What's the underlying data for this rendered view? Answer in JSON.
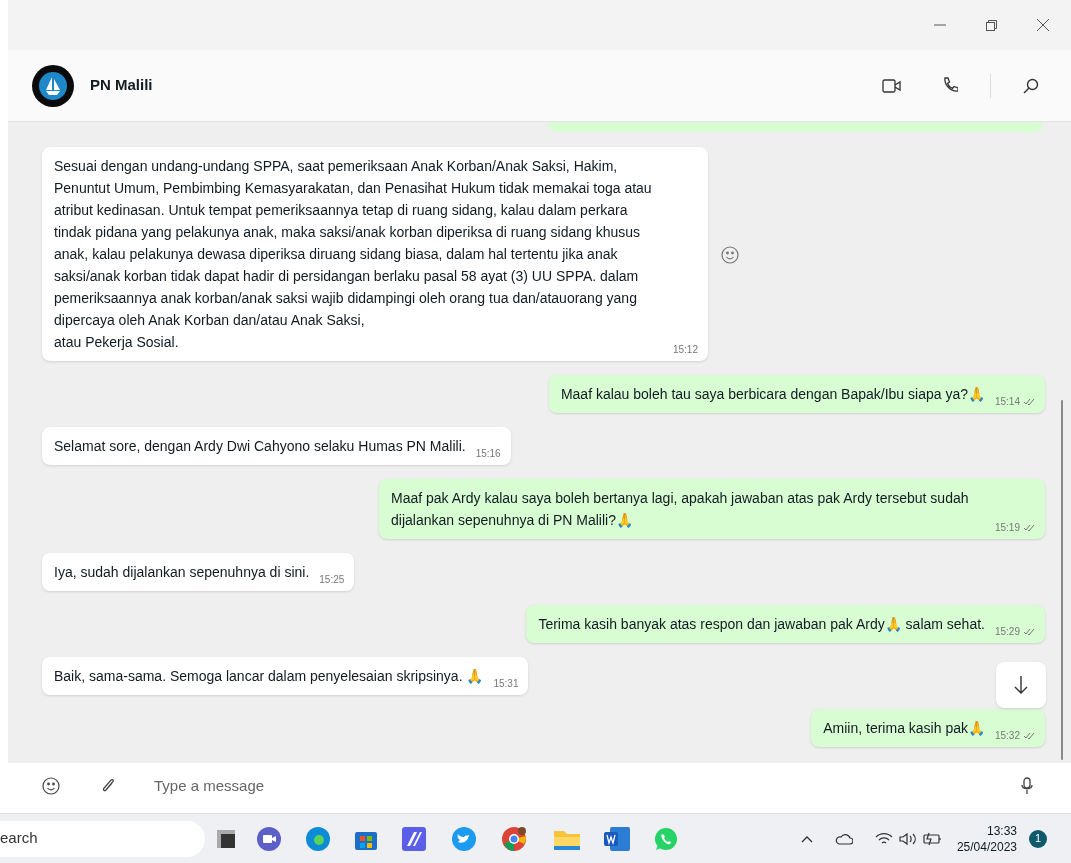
{
  "chat": {
    "name": "PN Malili"
  },
  "messages": [
    {
      "kind": "incoming",
      "text": "Sesuai dengan undang-undang SPPA, saat pemeriksaan Anak Korban/Anak Saksi, Hakim, Penuntut Umum, Pembimbing Kemasyarakatan, dan Penasihat Hukum tidak memakai toga atau atribut kedinasan. Untuk tempat pemeriksaannya tetap di ruang sidang, kalau dalam perkara tindak pidana yang pelakunya anak, maka saksi/anak korban diperiksa di ruang sidang khusus anak, kalau pelakunya dewasa diperiksa diruang sidang biasa, dalam hal tertentu jika anak saksi/anak korban tidak dapat hadir di persidangan berlaku pasal 58 ayat (3) UU SPPA. dalam pemeriksaannya anak korban/anak saksi wajib didampingi oleh orang tua dan/atauorang yang dipercaya oleh Anak Korban dan/atau Anak Saksi,\natau Pekerja Sosial.",
      "time": "15:12"
    },
    {
      "kind": "outgoing",
      "text": "Maaf kalau boleh tau saya berbicara dengan Bapak/Ibu siapa ya?🙏",
      "time": "15:14"
    },
    {
      "kind": "incoming",
      "text": "Selamat sore, dengan Ardy Dwi Cahyono selaku Humas PN Malili.",
      "time": "15:16"
    },
    {
      "kind": "outgoing",
      "text": "Maaf pak Ardy kalau saya boleh bertanya lagi, apakah jawaban atas pak Ardy tersebut sudah dijalankan sepenuhnya di PN Malili?🙏",
      "time": "15:19"
    },
    {
      "kind": "incoming",
      "text": "Iya, sudah dijalankan sepenuhnya di sini.",
      "time": "15:25"
    },
    {
      "kind": "outgoing",
      "text": "Terima kasih banyak atas respon dan jawaban pak Ardy🙏 salam sehat.",
      "time": "15:29"
    },
    {
      "kind": "incoming",
      "text": "Baik, sama-sama. Semoga lancar dalam penyelesaian skripsinya. 🙏",
      "time": "15:31"
    },
    {
      "kind": "outgoing",
      "text": "Amiin, terima kasih pak🙏",
      "time": "15:32"
    }
  ],
  "composer": {
    "placeholder": "Type a message"
  },
  "taskbar": {
    "search": "earch",
    "time": "13:33",
    "date": "25/04/2023",
    "notifications": "1"
  }
}
